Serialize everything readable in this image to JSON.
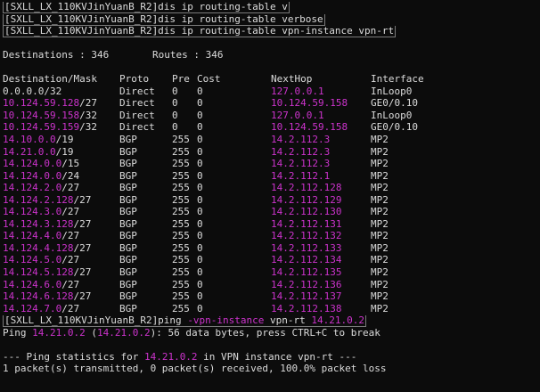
{
  "colors": {
    "background": "#0c0c0c",
    "text": "#dcdcdc",
    "highlight": "#cc33cc"
  },
  "commands": [
    "[SXLL_LX_110KVJinYuanB_R2]dis ip routing-table v",
    "[SXLL_LX_110KVJinYuanB_R2]dis ip routing-table verbose",
    "[SXLL_LX_110KVJinYuanB_R2]dis ip routing-table vpn-instance vpn-rt"
  ],
  "summary": {
    "destinations_label": "Destinations : 346",
    "routes_label": "Routes : 346"
  },
  "table_header": {
    "dest": "Destination/Mask",
    "proto": "Proto",
    "pre": "Pre",
    "cost": "Cost",
    "nexthop": "NextHop",
    "interface": "Interface"
  },
  "routes": [
    {
      "dest": "0.0.0.0/32",
      "proto": "Direct",
      "pre": "0",
      "cost": "0",
      "nexthop": "127.0.0.1",
      "interface": "InLoop0",
      "dest_hl": ""
    },
    {
      "dest": "10.124.59.128/27",
      "proto": "Direct",
      "pre": "0",
      "cost": "0",
      "nexthop": "10.124.59.158",
      "interface": "GE0/0.10",
      "dest_hl": "10.124.59.128"
    },
    {
      "dest": "10.124.59.158/32",
      "proto": "Direct",
      "pre": "0",
      "cost": "0",
      "nexthop": "127.0.0.1",
      "interface": "InLoop0",
      "dest_hl": "10.124.59.158"
    },
    {
      "dest": "10.124.59.159/32",
      "proto": "Direct",
      "pre": "0",
      "cost": "0",
      "nexthop": "10.124.59.158",
      "interface": "GE0/0.10",
      "dest_hl": "10.124.59.159"
    },
    {
      "dest": "14.10.0.0/19",
      "proto": "BGP",
      "pre": "255",
      "cost": "0",
      "nexthop": "14.2.112.3",
      "interface": "MP2",
      "dest_hl": "14.10.0.0"
    },
    {
      "dest": "14.21.0.0/19",
      "proto": "BGP",
      "pre": "255",
      "cost": "0",
      "nexthop": "14.2.112.3",
      "interface": "MP2",
      "dest_hl": "14.21.0.0"
    },
    {
      "dest": "14.124.0.0/15",
      "proto": "BGP",
      "pre": "255",
      "cost": "0",
      "nexthop": "14.2.112.3",
      "interface": "MP2",
      "dest_hl": "14.124.0.0"
    },
    {
      "dest": "14.124.0.0/24",
      "proto": "BGP",
      "pre": "255",
      "cost": "0",
      "nexthop": "14.2.112.1",
      "interface": "MP2",
      "dest_hl": "14.124.0.0"
    },
    {
      "dest": "14.124.2.0/27",
      "proto": "BGP",
      "pre": "255",
      "cost": "0",
      "nexthop": "14.2.112.128",
      "interface": "MP2",
      "dest_hl": "14.124.2.0"
    },
    {
      "dest": "14.124.2.128/27",
      "proto": "BGP",
      "pre": "255",
      "cost": "0",
      "nexthop": "14.2.112.129",
      "interface": "MP2",
      "dest_hl": "14.124.2.128"
    },
    {
      "dest": "14.124.3.0/27",
      "proto": "BGP",
      "pre": "255",
      "cost": "0",
      "nexthop": "14.2.112.130",
      "interface": "MP2",
      "dest_hl": "14.124.3.0"
    },
    {
      "dest": "14.124.3.128/27",
      "proto": "BGP",
      "pre": "255",
      "cost": "0",
      "nexthop": "14.2.112.131",
      "interface": "MP2",
      "dest_hl": "14.124.3.128"
    },
    {
      "dest": "14.124.4.0/27",
      "proto": "BGP",
      "pre": "255",
      "cost": "0",
      "nexthop": "14.2.112.132",
      "interface": "MP2",
      "dest_hl": "14.124.4.0"
    },
    {
      "dest": "14.124.4.128/27",
      "proto": "BGP",
      "pre": "255",
      "cost": "0",
      "nexthop": "14.2.112.133",
      "interface": "MP2",
      "dest_hl": "14.124.4.128"
    },
    {
      "dest": "14.124.5.0/27",
      "proto": "BGP",
      "pre": "255",
      "cost": "0",
      "nexthop": "14.2.112.134",
      "interface": "MP2",
      "dest_hl": "14.124.5.0"
    },
    {
      "dest": "14.124.5.128/27",
      "proto": "BGP",
      "pre": "255",
      "cost": "0",
      "nexthop": "14.2.112.135",
      "interface": "MP2",
      "dest_hl": "14.124.5.128"
    },
    {
      "dest": "14.124.6.0/27",
      "proto": "BGP",
      "pre": "255",
      "cost": "0",
      "nexthop": "14.2.112.136",
      "interface": "MP2",
      "dest_hl": "14.124.6.0"
    },
    {
      "dest": "14.124.6.128/27",
      "proto": "BGP",
      "pre": "255",
      "cost": "0",
      "nexthop": "14.2.112.137",
      "interface": "MP2",
      "dest_hl": "14.124.6.128"
    },
    {
      "dest": "14.124.7.0/27",
      "proto": "BGP",
      "pre": "255",
      "cost": "0",
      "nexthop": "14.2.112.138",
      "interface": "MP2",
      "dest_hl": "14.124.7.0"
    }
  ],
  "ping": {
    "prompt": "[SXLL_LX_110KVJinYuanB_R2]ping ",
    "option": "-vpn-instance",
    "instance": " vpn-rt ",
    "target": "14.21.0.2",
    "info_prefix": "Ping ",
    "info_target": "14.21.0.2",
    "info_mid": " (",
    "info_target2": "14.21.0.2",
    "info_suffix": "): 56 data bytes, press CTRL+C to break",
    "stats_prefix": "--- Ping statistics for ",
    "stats_target": "14.21.0.2",
    "stats_suffix": " in VPN instance vpn-rt ---",
    "result": "1 packet(s) transmitted, 0 packet(s) received, 100.0% packet loss"
  }
}
